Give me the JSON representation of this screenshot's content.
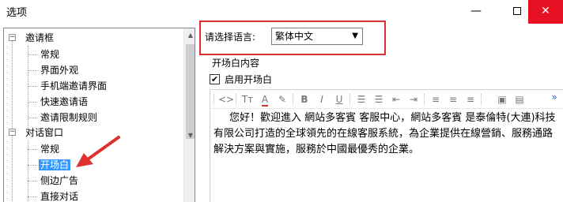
{
  "window": {
    "title": "选项"
  },
  "tree": {
    "items": [
      {
        "label": "邀请框",
        "level": 0,
        "expander": "−"
      },
      {
        "label": "常规",
        "level": 1
      },
      {
        "label": "界面外观",
        "level": 1
      },
      {
        "label": "手机端邀请界面",
        "level": 1
      },
      {
        "label": "快速邀请语",
        "level": 1
      },
      {
        "label": "邀请限制规则",
        "level": 1
      },
      {
        "label": "对话窗口",
        "level": 0,
        "expander": "−"
      },
      {
        "label": "常规",
        "level": 1
      },
      {
        "label": "开场白",
        "level": 1,
        "selected": true
      },
      {
        "label": "侧边广告",
        "level": 1
      },
      {
        "label": "直接对话",
        "level": 1
      }
    ]
  },
  "language": {
    "label": "请选择语言:",
    "selected": "繁体中文"
  },
  "greeting": {
    "section_title": "开场白内容",
    "enable_label": "启用开场白",
    "enabled": true,
    "content": "您好！歡迎進入 網站多客賓 客服中心，網站多客賓 是泰倫特(大連)科技有限公司打造的全球領先的在線客服系統，為企業提供在線營銷、服務通路解決方案與實施，服務於中國最優秀的企業。"
  },
  "colors": {
    "highlight_box": "#e03131",
    "selection": "#3399ff",
    "close_button": "#e81123"
  }
}
